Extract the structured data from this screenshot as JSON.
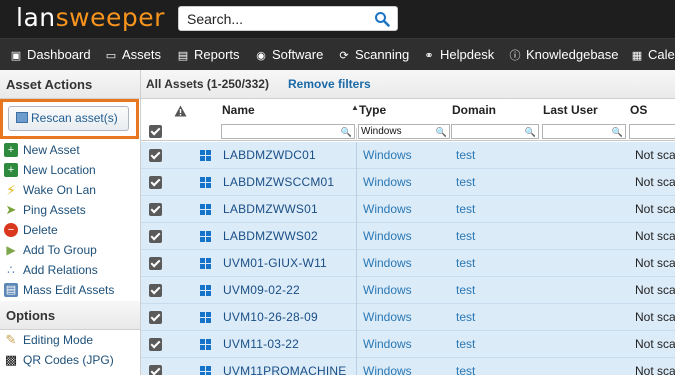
{
  "app": {
    "logo_main": "lan",
    "logo_accent": "sweeper"
  },
  "search": {
    "placeholder": "Search..."
  },
  "nav": {
    "items": [
      {
        "label": "Dashboard",
        "icon": "dashboard-icon"
      },
      {
        "label": "Assets",
        "icon": "monitor-icon"
      },
      {
        "label": "Reports",
        "icon": "report-icon"
      },
      {
        "label": "Software",
        "icon": "software-icon"
      },
      {
        "label": "Scanning",
        "icon": "scanning-icon"
      },
      {
        "label": "Helpdesk",
        "icon": "headset-icon"
      },
      {
        "label": "Knowledgebase",
        "icon": "info-icon"
      },
      {
        "label": "Calen",
        "icon": "calendar-icon"
      }
    ]
  },
  "sidebar": {
    "actions_title": "Asset Actions",
    "rescan_label": "Rescan asset(s)",
    "actions": [
      {
        "label": "New Asset",
        "icon": "plus-icon",
        "color": "#2e8b3e"
      },
      {
        "label": "New Location",
        "icon": "plus-icon",
        "color": "#2e8b3e"
      },
      {
        "label": "Wake On Lan",
        "icon": "lightning-icon",
        "color": "#e7b51a"
      },
      {
        "label": "Ping Assets",
        "icon": "ping-icon",
        "color": "#7aa23a"
      },
      {
        "label": "Delete",
        "icon": "delete-icon",
        "color": "#d9381e"
      },
      {
        "label": "Add To Group",
        "icon": "tag-icon",
        "color": "#7ea64a"
      },
      {
        "label": "Add Relations",
        "icon": "relations-icon",
        "color": "#4f7fb8"
      },
      {
        "label": "Mass Edit Assets",
        "icon": "mass-edit-icon",
        "color": "#5d87b6"
      }
    ],
    "options_title": "Options",
    "options": [
      {
        "label": "Editing Mode",
        "icon": "pencil-icon",
        "color": "#c9a04a"
      },
      {
        "label": "QR Codes (JPG)",
        "icon": "qr-code-icon",
        "color": "#111111"
      }
    ]
  },
  "main": {
    "title": "All Assets (1-250/332)",
    "remove_filters": "Remove filters",
    "columns": {
      "name": "Name",
      "type": "Type",
      "domain": "Domain",
      "last_user": "Last User",
      "os": "OS"
    },
    "filters": {
      "type": "Windows"
    },
    "rows": [
      {
        "name": "LABDMZWDC01",
        "type": "Windows",
        "domain": "test",
        "os": "Not sca"
      },
      {
        "name": "LABDMZWSCCM01",
        "type": "Windows",
        "domain": "test",
        "os": "Not sca"
      },
      {
        "name": "LABDMZWWS01",
        "type": "Windows",
        "domain": "test",
        "os": "Not sca"
      },
      {
        "name": "LABDMZWWS02",
        "type": "Windows",
        "domain": "test",
        "os": "Not sca"
      },
      {
        "name": "UVM01-GIUX-W11",
        "type": "Windows",
        "domain": "test",
        "os": "Not sca"
      },
      {
        "name": "UVM09-02-22",
        "type": "Windows",
        "domain": "test",
        "os": "Not sca"
      },
      {
        "name": "UVM10-26-28-09",
        "type": "Windows",
        "domain": "test",
        "os": "Not sca"
      },
      {
        "name": "UVM11-03-22",
        "type": "Windows",
        "domain": "test",
        "os": "Not sca"
      },
      {
        "name": "UVM11PROMACHINE",
        "type": "Windows",
        "domain": "test",
        "os": "Not sca"
      }
    ]
  },
  "colors": {
    "highlight_border": "#e8771f",
    "row_bg": "#dcebf8",
    "header_bg": "#1e1e1e",
    "nav_bg": "#2f2f2f"
  }
}
